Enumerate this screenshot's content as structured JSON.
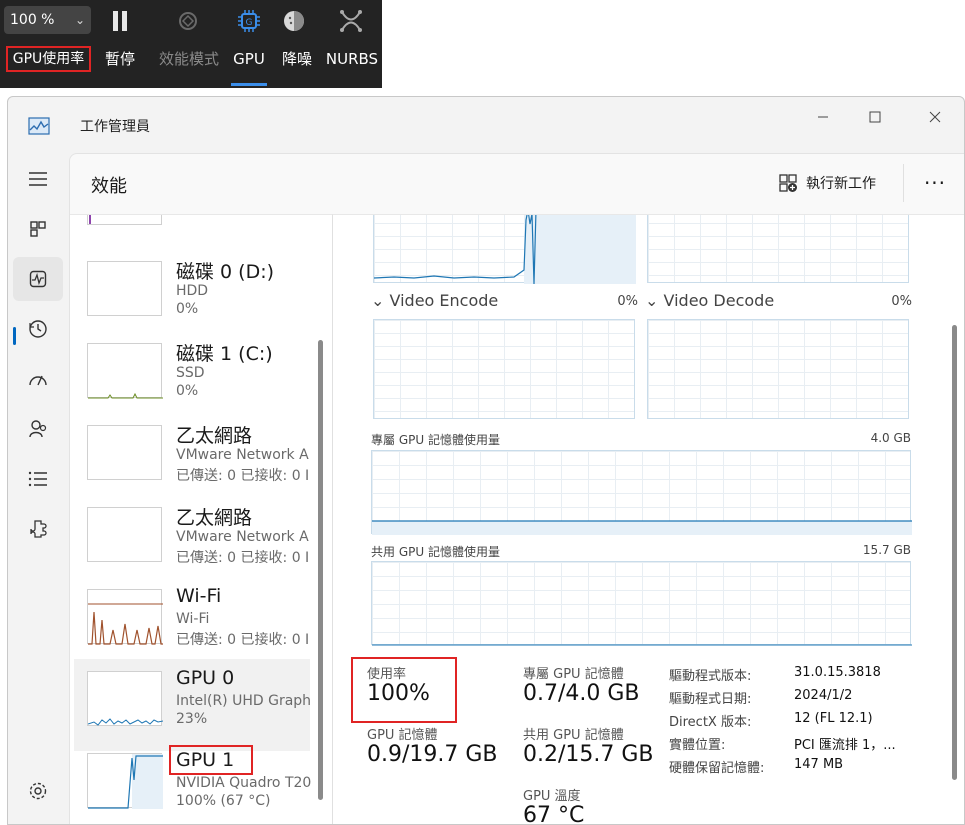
{
  "toolbar": {
    "zoom": "100 %",
    "items": [
      {
        "label": "GPU使用率",
        "icon": "gpu-usage-label",
        "state": "highlighted"
      },
      {
        "label": "暫停",
        "icon": "pause-icon",
        "state": "normal"
      },
      {
        "label": "效能模式",
        "icon": "performance-mode-icon",
        "state": "disabled"
      },
      {
        "label": "GPU",
        "icon": "gpu-chip-icon",
        "state": "selected"
      },
      {
        "label": "降噪",
        "icon": "denoise-icon",
        "state": "normal"
      },
      {
        "label": "NURBS",
        "icon": "nurbs-icon",
        "state": "normal"
      }
    ]
  },
  "window": {
    "title": "工作管理員",
    "page_title": "效能",
    "new_task_label": "執行新工作",
    "more_label": "···"
  },
  "devices": [
    {
      "name": "磁碟 0 (D:)",
      "sub1": "HDD",
      "sub2": "0%"
    },
    {
      "name": "磁碟 1 (C:)",
      "sub1": "SSD",
      "sub2": "0%"
    },
    {
      "name": "乙太網路",
      "sub1": "VMware Network A",
      "sub2": "已傳送: 0 已接收: 0 I"
    },
    {
      "name": "乙太網路",
      "sub1": "VMware Network A",
      "sub2": "已傳送: 0 已接收: 0 I"
    },
    {
      "name": "Wi-Fi",
      "sub1": "Wi-Fi",
      "sub2": "已傳送: 0 已接收: 0 I"
    },
    {
      "name": "GPU 0",
      "sub1": "Intel(R) UHD Graph",
      "sub2": "23%"
    },
    {
      "name": "GPU 1",
      "sub1": "NVIDIA Quadro T20",
      "sub2": "100% (67 °C)"
    }
  ],
  "detail": {
    "video_encode": {
      "label": "Video Encode",
      "value": "0%"
    },
    "video_decode": {
      "label": "Video Decode",
      "value": "0%"
    },
    "dedicated_mem": {
      "label": "專屬 GPU 記憶體使用量",
      "max": "4.0 GB"
    },
    "shared_mem": {
      "label": "共用 GPU 記憶體使用量",
      "max": "15.7 GB"
    },
    "stats": {
      "usage_label": "使用率",
      "usage_value": "100%",
      "gpu_mem_label": "GPU 記憶體",
      "gpu_mem_value": "0.9/19.7 GB",
      "dedicated_label": "專屬 GPU 記憶體",
      "dedicated_value": "0.7/4.0 GB",
      "shared_label": "共用 GPU 記憶體",
      "shared_value": "0.2/15.7 GB",
      "temp_label": "GPU 溫度",
      "temp_value": "67 °C"
    },
    "info": [
      {
        "key": "驅動程式版本:",
        "value": "31.0.15.3818"
      },
      {
        "key": "驅動程式日期:",
        "value": "2024/1/2"
      },
      {
        "key": "DirectX 版本:",
        "value": "12 (FL 12.1)"
      },
      {
        "key": "實體位置:",
        "value": "PCI 匯流排 1，..."
      },
      {
        "key": "硬體保留記憶體:",
        "value": "147 MB"
      }
    ]
  },
  "colors": {
    "accent": "#0067c0",
    "highlight": "#e02424",
    "wifi_graph": "#a0522d",
    "gpu_graph": "#1f77b4"
  }
}
